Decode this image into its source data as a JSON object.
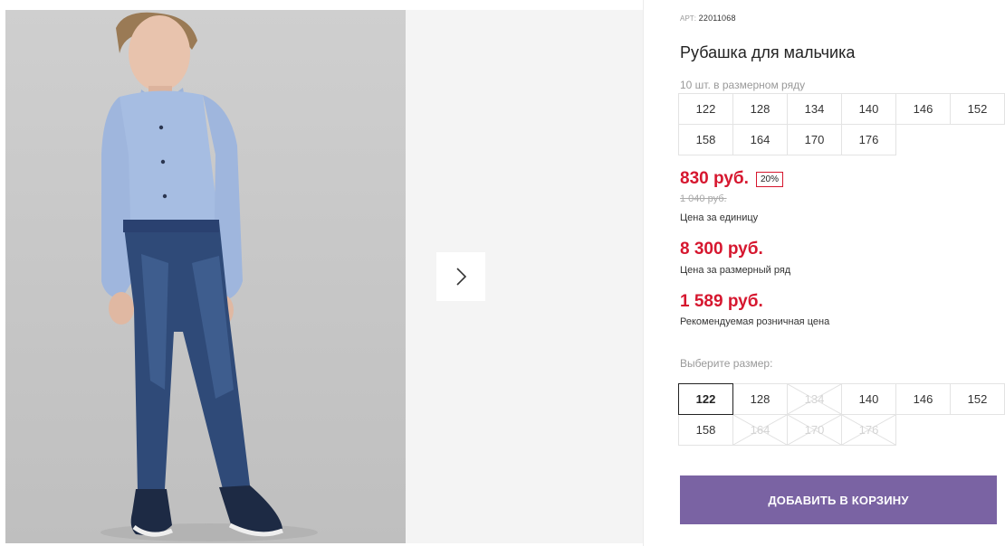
{
  "product": {
    "article_label": "АРТ:",
    "article_number": "22011068",
    "title": "Рубашка для мальчика",
    "pack_info": "10 шт. в размерном ряду",
    "pack_sizes": [
      "122",
      "128",
      "134",
      "140",
      "146",
      "152",
      "158",
      "164",
      "170",
      "176"
    ]
  },
  "pricing": {
    "price": "830 руб.",
    "discount_badge": "20%",
    "old_price": "1 040 руб.",
    "unit_caption": "Цена за единицу",
    "pack_price": "8 300 руб.",
    "pack_caption": "Цена за размерный ряд",
    "retail_price": "1 589 руб.",
    "retail_caption": "Рекомендуемая розничная цена",
    "accent_color": "#d6172f"
  },
  "size_selector": {
    "label": "Выберите размер:",
    "selected": "122",
    "options": [
      {
        "size": "122",
        "available": true
      },
      {
        "size": "128",
        "available": true
      },
      {
        "size": "134",
        "available": false
      },
      {
        "size": "140",
        "available": true
      },
      {
        "size": "146",
        "available": true
      },
      {
        "size": "152",
        "available": true
      },
      {
        "size": "158",
        "available": true
      },
      {
        "size": "164",
        "available": false
      },
      {
        "size": "170",
        "available": false
      },
      {
        "size": "176",
        "available": false
      }
    ]
  },
  "actions": {
    "add_to_cart": "ДОБАВИТЬ В КОРЗИНУ",
    "button_color": "#7a63a3"
  },
  "gallery": {
    "next_icon": "chevron-right-icon"
  }
}
